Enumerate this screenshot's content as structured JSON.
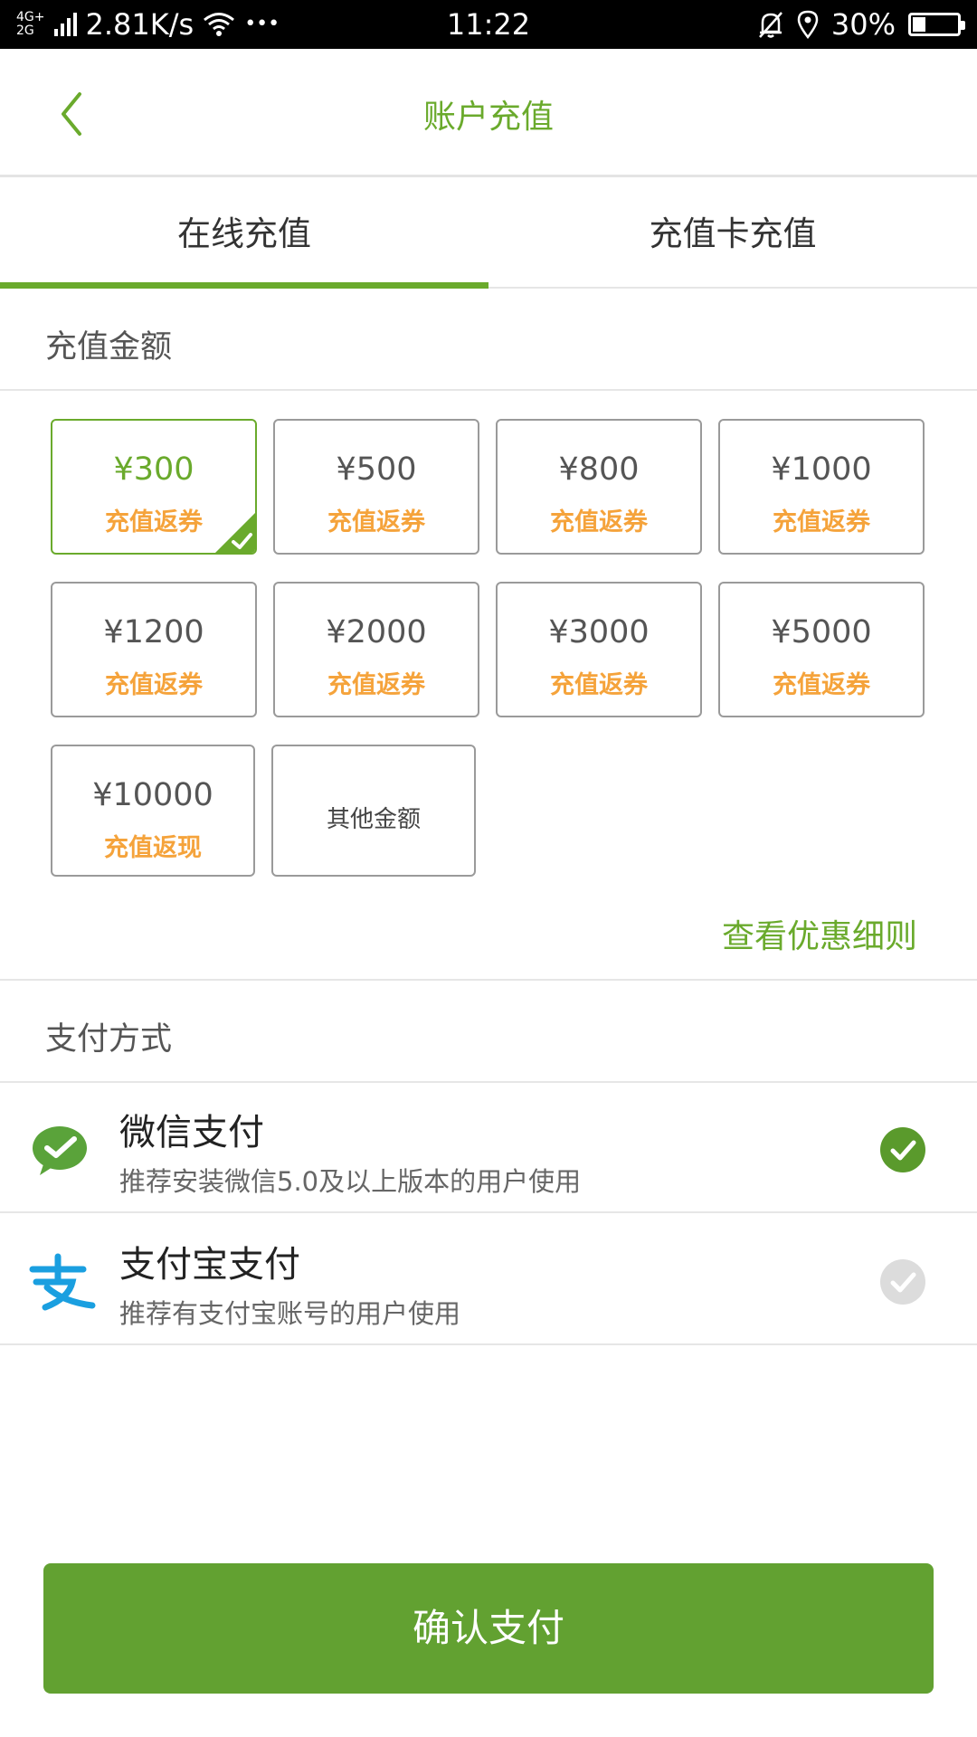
{
  "status_bar": {
    "network": "4G+\n2G",
    "speed": "2.81K/s",
    "dots": "•••",
    "time": "11:22",
    "battery": "30%",
    "battery_level": 0.3
  },
  "header": {
    "title": "账户充值"
  },
  "tabs": [
    {
      "label": "在线充值",
      "active": true
    },
    {
      "label": "充值卡充值",
      "active": false
    }
  ],
  "amount_section": {
    "label": "充值金额",
    "options": [
      {
        "price": "¥300",
        "tag": "充值返券",
        "selected": true
      },
      {
        "price": "¥500",
        "tag": "充值返券",
        "selected": false
      },
      {
        "price": "¥800",
        "tag": "充值返券",
        "selected": false
      },
      {
        "price": "¥1000",
        "tag": "充值返券",
        "selected": false
      },
      {
        "price": "¥1200",
        "tag": "充值返券",
        "selected": false
      },
      {
        "price": "¥2000",
        "tag": "充值返券",
        "selected": false
      },
      {
        "price": "¥3000",
        "tag": "充值返券",
        "selected": false
      },
      {
        "price": "¥5000",
        "tag": "充值返券",
        "selected": false
      },
      {
        "price": "¥10000",
        "tag": "充值返现",
        "selected": false
      }
    ],
    "other_label": "其他金额",
    "rules_link": "查看优惠细则"
  },
  "payment_section": {
    "label": "支付方式",
    "methods": [
      {
        "title": "微信支付",
        "desc": "推荐安装微信5.0及以上版本的用户使用",
        "icon": "wechat-pay-icon",
        "selected": true
      },
      {
        "title": "支付宝支付",
        "desc": "推荐有支付宝账号的用户使用",
        "icon": "alipay-icon",
        "selected": false
      }
    ]
  },
  "confirm_button": "确认支付",
  "colors": {
    "accent": "#6aaa2c",
    "button": "#62a131",
    "tag": "#f5a33b",
    "alipay": "#1a9fe0",
    "wechat": "#5aa33a"
  }
}
